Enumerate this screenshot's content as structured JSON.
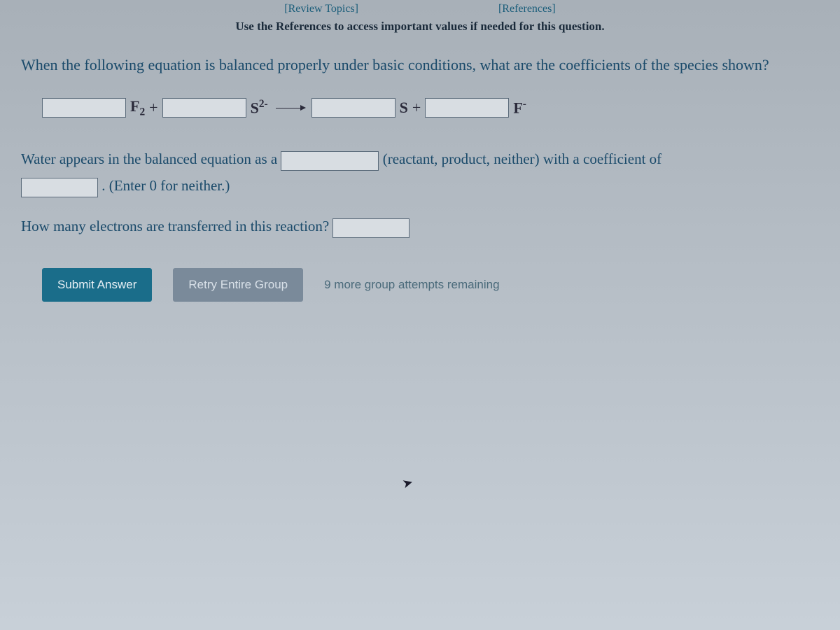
{
  "topLinks": {
    "review": "[Review Topics]",
    "references": "[References]"
  },
  "instruction": "Use the References to access important values if needed for this question.",
  "question": "When the following equation is balanced properly under basic conditions, what are the coefficients of the species shown?",
  "equation": {
    "species1": {
      "base": "F",
      "sub": "2"
    },
    "plus1": "+",
    "species2": {
      "base": "S",
      "sup": "2-"
    },
    "species3": {
      "base": "S"
    },
    "plus2": "+",
    "species4": {
      "base": "F",
      "sup": "-"
    }
  },
  "water": {
    "pre": "Water appears in the balanced equation as a",
    "post": "(reactant, product, neither) with a coefficient of",
    "hint": ". (Enter 0 for neither.)"
  },
  "electrons": {
    "text": "How many electrons are transferred in this reaction?"
  },
  "buttons": {
    "submit": "Submit Answer",
    "retry": "Retry Entire Group"
  },
  "attempts": "9 more group attempts remaining"
}
